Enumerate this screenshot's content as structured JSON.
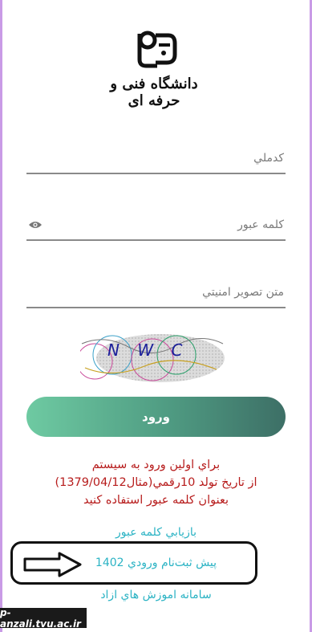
{
  "logo": {
    "text": "دانشگاه فنی و حرفه ای"
  },
  "form": {
    "national_code_placeholder": "كدملي",
    "password_placeholder": "كلمه عبور",
    "captcha_placeholder": "متن تصوير امنيتي",
    "captcha_text": "N W C",
    "login_label": "ورود"
  },
  "notice": {
    "line1": "براي اولين ورود به سيستم",
    "line2": "از تاريخ تولد 10رقمي(مثال1379/04/12)",
    "line3": "بعنوان كلمه عبور استفاده كنيد"
  },
  "links": {
    "recover_password": "بازيابي كلمه عبور",
    "pre_registration": "پيش ثبت‌نام ورودي 1402",
    "free_education": "سامانه اموزش هاي ازاد"
  },
  "watermark": {
    "text": "p-anzali.tvu.ac.ir"
  },
  "colors": {
    "accent_start": "#6ecaa2",
    "accent_end": "#3d6f66",
    "notice_red": "#b71c1c",
    "link_teal": "#2bb3c4",
    "frame_purple": "#c99be6"
  }
}
